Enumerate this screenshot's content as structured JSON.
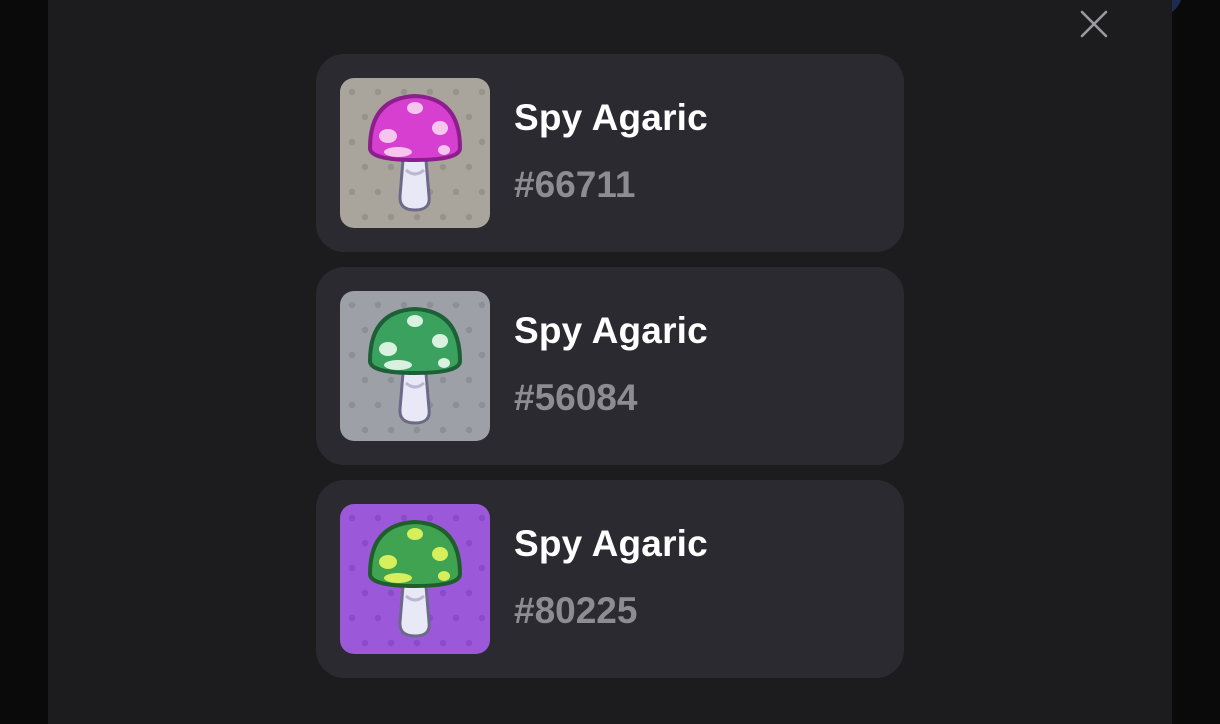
{
  "close_button": {
    "icon": "close-icon"
  },
  "items": [
    {
      "name": "Spy Agaric",
      "number": "#66711",
      "image": {
        "bg": "#a9a59d",
        "pattern_color": "#8f8b84",
        "cap_color": "#d63fcf",
        "cap_dark": "#8d1f8c",
        "spot_color": "#f4c6ee",
        "icon": "pink-mushroom-icon"
      }
    },
    {
      "name": "Spy Agaric",
      "number": "#56084",
      "image": {
        "bg": "#9ea0a7",
        "pattern_color": "#85878e",
        "cap_color": "#3aa25e",
        "cap_dark": "#1f5f37",
        "spot_color": "#d9f2df",
        "icon": "green-mushroom-icon"
      }
    },
    {
      "name": "Spy Agaric",
      "number": "#80225",
      "image": {
        "bg": "#9b58d8",
        "pattern_color": "#8645c6",
        "cap_color": "#3fa351",
        "cap_dark": "#1f5e2c",
        "spot_color": "#d6ef5a",
        "icon": "lime-spotted-mushroom-icon"
      }
    }
  ]
}
